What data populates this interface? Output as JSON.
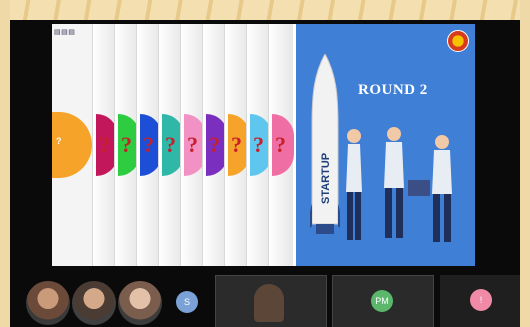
{
  "slide": {
    "round_label": "ROUND 2",
    "startup_label": "STARTUP",
    "spine_glyph": "?",
    "spine_colors": [
      "#c2185b",
      "#2ecc40",
      "#1d4fd6",
      "#2fb7a8",
      "#f291c4",
      "#7b2fbf",
      "#f6a32a",
      "#5fc6ee",
      "#ef6fa5"
    ]
  },
  "participants": [
    {
      "name": "",
      "kind": "avatar-photo"
    },
    {
      "name": "",
      "kind": "avatar-photo"
    },
    {
      "name": "",
      "kind": "avatar-photo"
    },
    {
      "name": "",
      "kind": "initial",
      "initial": "S",
      "color": "#7aa2d6"
    },
    {
      "name": "",
      "kind": "camera"
    },
    {
      "name": "",
      "kind": "initial",
      "initial": "PM",
      "color": "#5bb76c"
    },
    {
      "name": "",
      "kind": "initial",
      "initial": "!",
      "color": "#f08aa6"
    }
  ]
}
